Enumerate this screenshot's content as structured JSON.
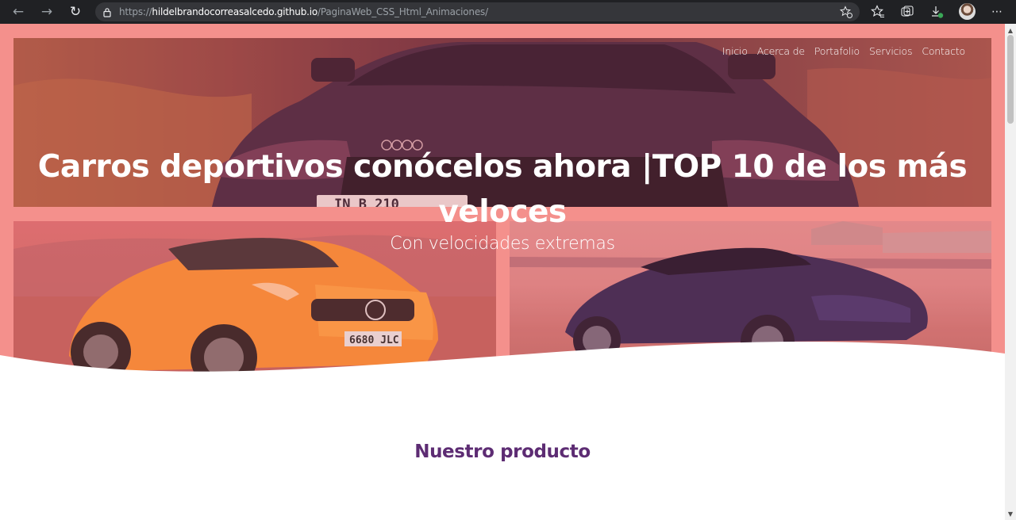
{
  "browser": {
    "url_prefix": "https://",
    "url_host": "hildelbrandocorreasalcedo.github.io",
    "url_path": "/PaginaWeb_CSS_Html_Animaciones/",
    "back_icon": "←",
    "forward_icon": "→",
    "reload_icon": "↻",
    "more_icon": "⋯"
  },
  "nav": {
    "items": [
      {
        "label": "Inicio"
      },
      {
        "label": "Acerca de"
      },
      {
        "label": "Portafolio"
      },
      {
        "label": "Servicios"
      },
      {
        "label": "Contacto"
      }
    ]
  },
  "hero": {
    "title": "Carros deportivos conócelos ahora |TOP 10 de los más veloces",
    "subtitle": "Con velocidades extremas",
    "overlay_color": "#f59591"
  },
  "plates": {
    "left": "6680 JLC",
    "top": "IN B 210"
  },
  "section": {
    "title": "Nuestro producto",
    "title_color": "#5d2c73"
  }
}
